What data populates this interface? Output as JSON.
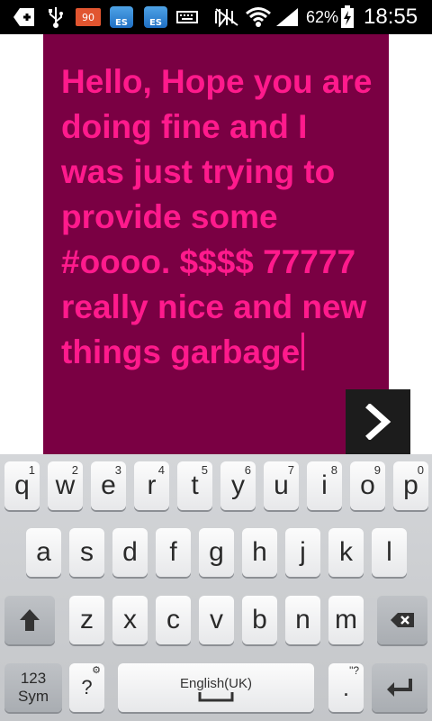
{
  "status_bar": {
    "notification_badge": "90",
    "es_label_1": "ES",
    "es_label_2": "ES",
    "battery_percent": "62%",
    "time": "18:55"
  },
  "editor": {
    "text": "Hello, Hope you are doing fine and I was just trying to provide some #oooo. $$$$ 77777 really nice and new things garbage"
  },
  "keyboard": {
    "row1": [
      {
        "key": "q",
        "num": "1"
      },
      {
        "key": "w",
        "num": "2"
      },
      {
        "key": "e",
        "num": "3"
      },
      {
        "key": "r",
        "num": "4"
      },
      {
        "key": "t",
        "num": "5"
      },
      {
        "key": "y",
        "num": "6"
      },
      {
        "key": "u",
        "num": "7"
      },
      {
        "key": "i",
        "num": "8"
      },
      {
        "key": "o",
        "num": "9"
      },
      {
        "key": "p",
        "num": "0"
      }
    ],
    "row2": [
      "a",
      "s",
      "d",
      "f",
      "g",
      "h",
      "j",
      "k",
      "l"
    ],
    "row3": [
      "z",
      "x",
      "c",
      "v",
      "b",
      "n",
      "m"
    ],
    "sym_line1": "123",
    "sym_line2": "Sym",
    "question_key": "?",
    "space_language": "English(UK)",
    "period_key": ".",
    "period_sup": "\"?"
  },
  "colors": {
    "card_background": "#7a0043",
    "text_color": "#ff1a8c",
    "status_bar": "#000000"
  }
}
